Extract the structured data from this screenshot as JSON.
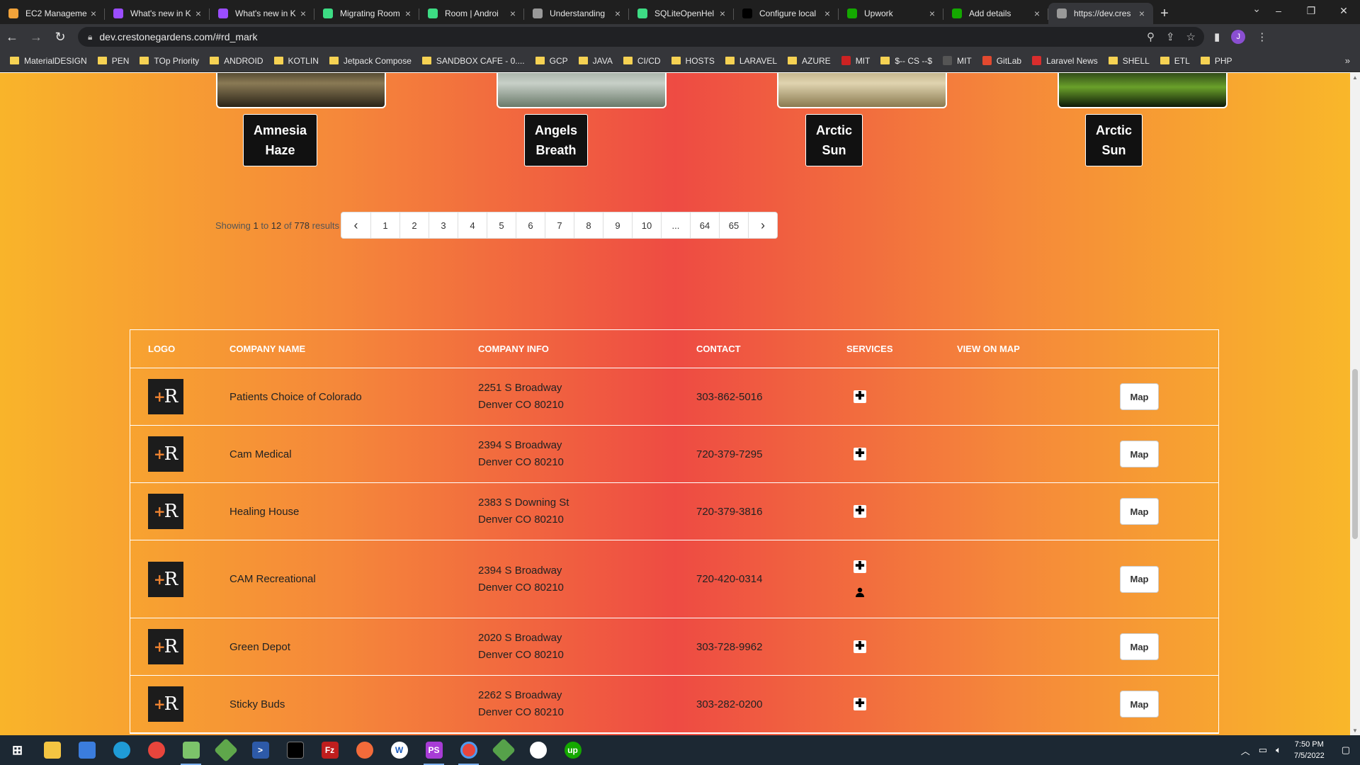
{
  "browser": {
    "tabs": [
      {
        "title": "EC2 Manageme",
        "icon": "aws-icon",
        "color": "#f2a33a"
      },
      {
        "title": "What's new in K",
        "icon": "kotlin-icon",
        "color": "#9b4dff"
      },
      {
        "title": "What's new in K",
        "icon": "kotlin-icon",
        "color": "#9b4dff"
      },
      {
        "title": "Migrating Room",
        "icon": "android-icon",
        "color": "#3ddc84"
      },
      {
        "title": "Room | Androi",
        "icon": "android-icon",
        "color": "#3ddc84"
      },
      {
        "title": "Understanding",
        "icon": "globe-icon",
        "color": "#999999"
      },
      {
        "title": "SQLiteOpenHel",
        "icon": "android-icon",
        "color": "#3ddc84"
      },
      {
        "title": "Configure local",
        "icon": "jetbrains-icon",
        "color": "#000000"
      },
      {
        "title": "Upwork",
        "icon": "upwork-icon",
        "color": "#14a800"
      },
      {
        "title": "Add details",
        "icon": "upwork-icon",
        "color": "#14a800"
      },
      {
        "title": "https://dev.cres",
        "icon": "globe-icon",
        "color": "#999999"
      }
    ],
    "url": "dev.crestonegardens.com/#rd_mark",
    "profile_initial": "J",
    "bookmarks": [
      {
        "label": "MaterialDESIGN"
      },
      {
        "label": "PEN"
      },
      {
        "label": "TOp Priority"
      },
      {
        "label": "ANDROID"
      },
      {
        "label": "KOTLIN"
      },
      {
        "label": "Jetpack Compose"
      },
      {
        "label": "SANDBOX CAFE - 0...."
      },
      {
        "label": "GCP"
      },
      {
        "label": "JAVA"
      },
      {
        "label": "CI/CD"
      },
      {
        "label": "HOSTS"
      },
      {
        "label": "LARAVEL"
      },
      {
        "label": "AZURE"
      },
      {
        "label": "MIT"
      },
      {
        "label": "$-- CS --$"
      },
      {
        "label": "MIT"
      },
      {
        "label": "GitLab"
      },
      {
        "label": "Laravel News"
      },
      {
        "label": "SHELL"
      },
      {
        "label": "ETL"
      },
      {
        "label": "PHP"
      }
    ]
  },
  "products": [
    {
      "line1": "Amnesia",
      "line2": "Haze"
    },
    {
      "line1": "Angels",
      "line2": "Breath"
    },
    {
      "line1": "Arctic",
      "line2": "Sun"
    },
    {
      "line1": "Arctic",
      "line2": "Sun"
    }
  ],
  "pagination": {
    "showing_prefix": "Showing ",
    "from": "1",
    "to_word": " to ",
    "to": "12",
    "of_word": " of ",
    "total": "778",
    "suffix": " results",
    "pages": [
      "1",
      "2",
      "3",
      "4",
      "5",
      "6",
      "7",
      "8",
      "9",
      "10",
      "...",
      "64",
      "65"
    ],
    "prev": "‹",
    "next": "›"
  },
  "table": {
    "headers": {
      "logo": "LOGO",
      "company_name": "COMPANY NAME",
      "company_info": "COMPANY INFO",
      "contact": "CONTACT",
      "services": "SERVICES",
      "view_on_map": "VIEW ON MAP"
    },
    "map_label": "Map",
    "logo_letter": "R",
    "logo_plus": "+",
    "rows": [
      {
        "name": "Patients Choice of Colorado",
        "addr1": "2251 S Broadway",
        "addr2": "Denver CO 80210",
        "phone": "303-862-5016",
        "services": [
          "medical"
        ]
      },
      {
        "name": "Cam Medical",
        "addr1": "2394 S Broadway",
        "addr2": "Denver CO 80210",
        "phone": "720-379-7295",
        "services": [
          "medical"
        ]
      },
      {
        "name": "Healing House",
        "addr1": "2383 S Downing St",
        "addr2": "Denver CO 80210",
        "phone": "720-379-3816",
        "services": [
          "medical"
        ]
      },
      {
        "name": "CAM Recreational",
        "addr1": "2394 S Broadway",
        "addr2": "Denver CO 80210",
        "phone": "720-420-0314",
        "services": [
          "medical",
          "recreational"
        ]
      },
      {
        "name": "Green Depot",
        "addr1": "2020 S Broadway",
        "addr2": "Denver CO 80210",
        "phone": "303-728-9962",
        "services": [
          "medical"
        ]
      },
      {
        "name": "Sticky Buds",
        "addr1": "2262 S Broadway",
        "addr2": "Denver CO 80210",
        "phone": "303-282-0200",
        "services": [
          "medical"
        ]
      }
    ]
  },
  "taskbar": {
    "time": "7:50 PM",
    "date": "7/5/2022"
  }
}
